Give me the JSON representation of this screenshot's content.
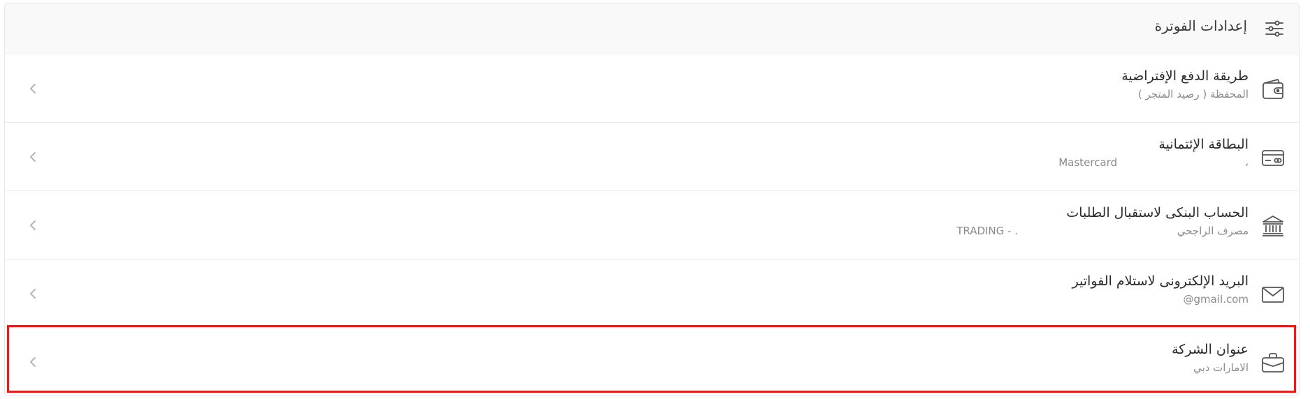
{
  "header": {
    "title": "إعدادات الفوترة",
    "icon": "sliders-icon"
  },
  "rows": [
    {
      "title": "طريقة الدفع الإفتراضية",
      "subtitle": "المحفظة ( رصيد المتجر )",
      "icon": "wallet-icon"
    },
    {
      "title": "البطاقة الإئتمانية",
      "subtitle": "،",
      "subtitle_secondary": "Mastercard",
      "icon": "credit-card-icon"
    },
    {
      "title": "الحساب البنكى لاستقبال الطلبات",
      "subtitle": "مصرف الراجحي",
      "subtitle_secondary": "TRADING - .",
      "icon": "bank-icon"
    },
    {
      "title": "البريد الإلكترونى لاستلام الفواتير",
      "subtitle": "@gmail.com",
      "icon": "envelope-icon"
    },
    {
      "title": "عنوان الشركة",
      "subtitle": "الامارات دبي",
      "icon": "briefcase-icon"
    }
  ],
  "highlight": {
    "color": "#e21e1e",
    "row_index": 4
  }
}
